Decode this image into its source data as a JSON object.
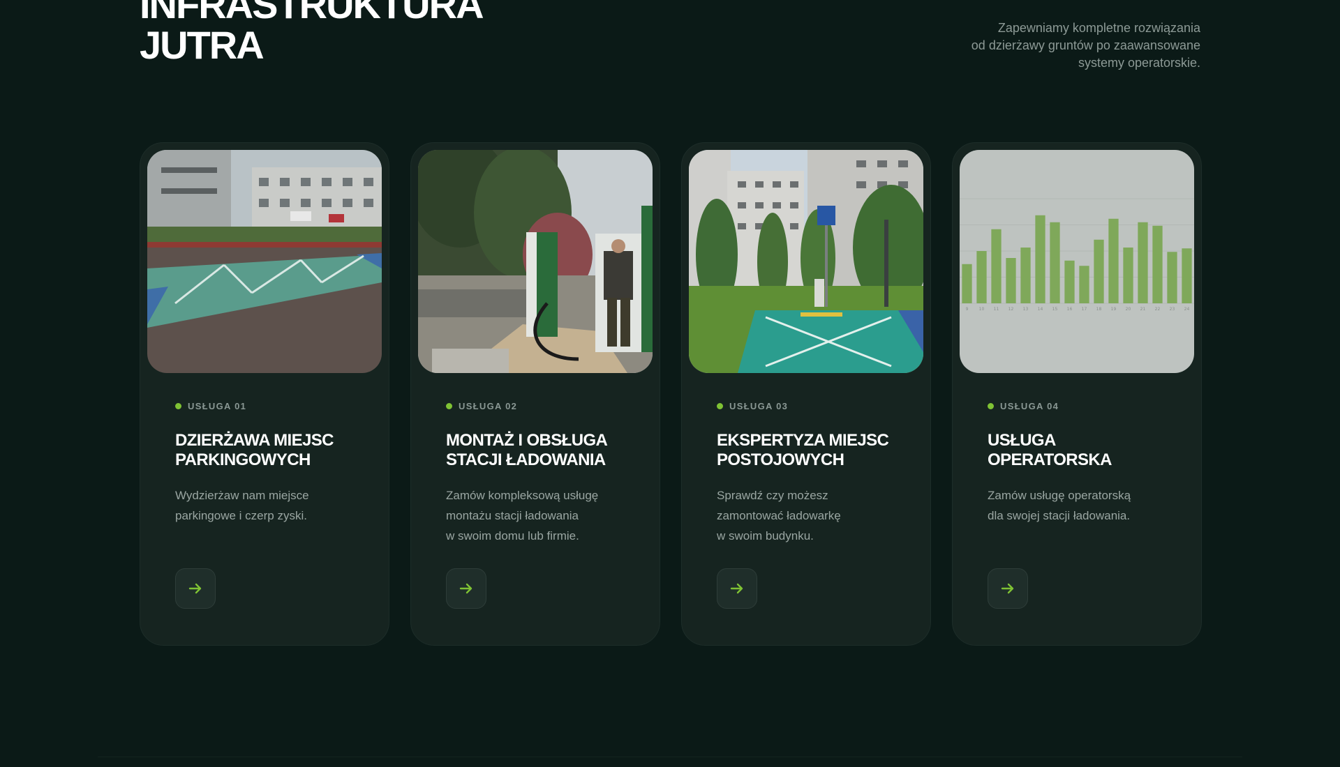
{
  "hero": {
    "title_line1": "INFRASTRUKTURA",
    "title_line2": "JUTRA",
    "description_line1": "Zapewniamy kompletne rozwiązania",
    "description_line2": "od dzierżawy gruntów po zaawansowane",
    "description_line3": "systemy operatorskie."
  },
  "colors": {
    "background": "#0b1a17",
    "card": "#162420",
    "accent": "#7fc234"
  },
  "services": [
    {
      "tag": "USŁUGA 01",
      "title_line1": "DZIERŻAWA MIEJSC",
      "title_line2": "PARKINGOWYCH",
      "desc_line1": "Wydzierżaw nam miejsce",
      "desc_line2": "parkingowe i czerp zyski.",
      "desc_line3": "",
      "image": "parking-lot-photo",
      "button_icon": "arrow-right-icon"
    },
    {
      "tag": "USŁUGA 02",
      "title_line1": "MONTAŻ I OBSŁUGA",
      "title_line2": "STACJI ŁADOWANIA",
      "desc_line1": "Zamów kompleksową usługę",
      "desc_line2": "montażu stacji ładowania",
      "desc_line3": "w swoim domu lub firmie.",
      "image": "charger-installation-photo",
      "button_icon": "arrow-right-icon"
    },
    {
      "tag": "USŁUGA 03",
      "title_line1": "EKSPERTYZA MIEJSC",
      "title_line2": "POSTOJOWYCH",
      "desc_line1": "Sprawdź czy możesz",
      "desc_line2": "zamontować ładowarkę",
      "desc_line3": "w swoim budynku.",
      "image": "ev-parking-space-photo",
      "button_icon": "arrow-right-icon"
    },
    {
      "tag": "USŁUGA 04",
      "title_line1": "USŁUGA",
      "title_line2": "OPERATORSKA",
      "desc_line1": "Zamów usługę operatorską",
      "desc_line2": "dla swojej stacji ładowania.",
      "desc_line3": "",
      "image": "usage-bar-chart",
      "button_icon": "arrow-right-icon"
    }
  ],
  "chart_data": {
    "type": "bar",
    "categories": [
      "9",
      "10",
      "11",
      "12",
      "13",
      "14",
      "15",
      "16",
      "17",
      "18",
      "19",
      "20",
      "21",
      "22",
      "23",
      "24"
    ],
    "series": [
      {
        "values": [
          4.5,
          6,
          8.5,
          5.2,
          6.4,
          10.1,
          9.3,
          4.9,
          4.3,
          7.3,
          9.7,
          6.4,
          9.3,
          8.9,
          5.9,
          6.3
        ]
      }
    ],
    "title": "",
    "xlabel": "",
    "ylabel": "",
    "ylim": [
      0,
      12
    ],
    "grid": true
  }
}
